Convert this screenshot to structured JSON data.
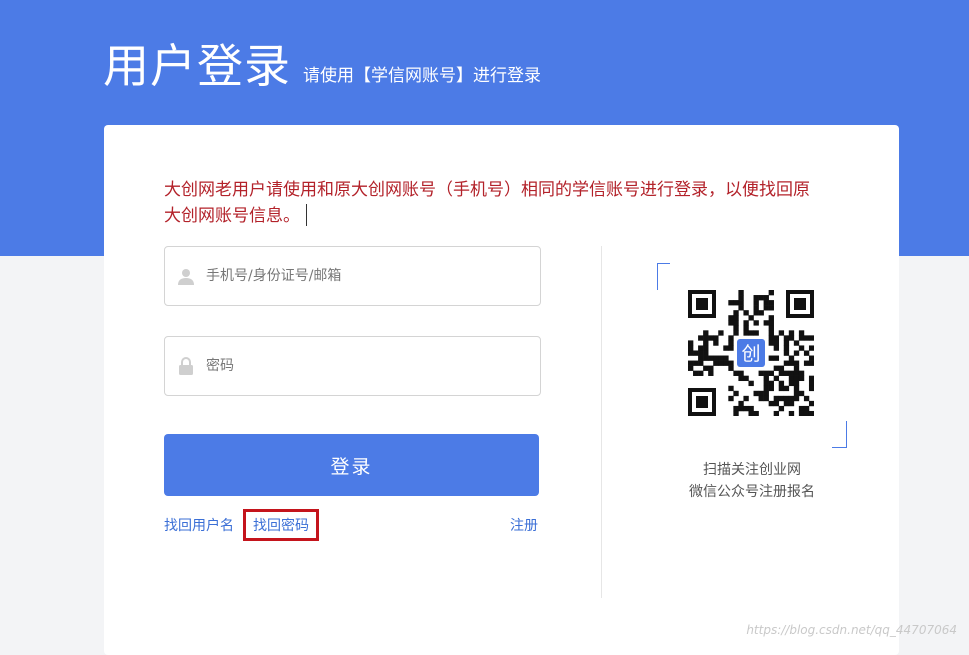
{
  "header": {
    "title": "用户登录",
    "subtitle": "请使用【学信网账号】进行登录"
  },
  "notice": {
    "line1": "大创网老用户请使用和原大创网账号（手机号）相同的学信账号进行登录，以便找回原",
    "line2": "大创网账号信息。"
  },
  "form": {
    "account_placeholder": "手机号/身份证号/邮箱",
    "account_icon": "user-icon",
    "password_placeholder": "密码",
    "password_icon": "lock-icon",
    "login_label": "登录"
  },
  "links": {
    "recover_username": "找回用户名",
    "recover_password": "找回密码",
    "register": "注册"
  },
  "qr": {
    "caption_line1": "扫描关注创业网",
    "caption_line2": "微信公众号注册报名",
    "center_glyph": "创"
  },
  "watermark": "https://blog.csdn.net/qq_44707064",
  "colors": {
    "primary": "#4c7be6",
    "notice": "#b3222a",
    "highlight_border": "#c4141c",
    "link": "#3b6fd6"
  }
}
